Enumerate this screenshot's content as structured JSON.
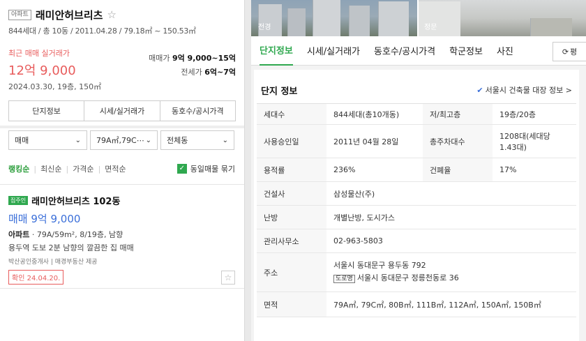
{
  "left": {
    "type_badge": "아파트",
    "name": "래미안허브리츠",
    "star": "☆",
    "info": "844세대 / 총 10동 / 2011.04.28 / 79.18㎡ ~ 150.53㎡",
    "recent_label": "최근 매매 실거래가",
    "recent_price": "12억 9,000",
    "recent_date": "2024.03.30, 19층, 150㎡",
    "sale_label": "매매가 ",
    "sale_value": "9억 9,000~15억",
    "jeonse_label": "전세가 ",
    "jeonse_value": "6억~7억",
    "tabs": [
      "단지정보",
      "시세/실거래가",
      "동호수/공시가격"
    ],
    "filters": [
      "매매",
      "79A㎡,79C⋯",
      "전체동"
    ],
    "sorts": [
      "랭킹순",
      "최신순",
      "가격순",
      "면적순"
    ],
    "bundle_label": "동일매물 묶기",
    "listing": {
      "badge": "집주인",
      "name": "래미안허브리츠 102동",
      "price": "매매 9억 9,000",
      "type": "아파트",
      "detail": " · 79A/59m², 8/19층, 남향",
      "desc": "용두역 도보 2분 남향의 깔끔한 집 매매",
      "agent": "박산공인중개사 | 매경부동산 제공",
      "confirm": "확인 24.04.20."
    }
  },
  "right": {
    "photo_labels": [
      "전경",
      "정문"
    ],
    "tabs": [
      "단지정보",
      "시세/실거래가",
      "동호수/공시가격",
      "학군정보",
      "사진"
    ],
    "refresh_label": "평",
    "info_title": "단지 정보",
    "bldg_link": "서울시 건축물 대장 정보 >",
    "rows": {
      "households_label": "세대수",
      "households": "844세대(총10개동)",
      "floors_label": "저/최고층",
      "floors": "19층/20층",
      "approval_label": "사용승인일",
      "approval": "2011년 04월 28일",
      "parking_label": "총주차대수",
      "parking": "1208대(세대당 1.43대)",
      "far_label": "용적률",
      "far": "236%",
      "bcr_label": "건폐율",
      "bcr": "17%",
      "builder_label": "건설사",
      "builder": "삼성물산(주)",
      "heating_label": "난방",
      "heating": "개별난방, 도시가스",
      "office_label": "관리사무소",
      "office": "02-963-5803",
      "address_label": "주소",
      "address": "서울시 동대문구 용두동 792",
      "road_badge": "도로명",
      "road_address": "서울시 동대문구 정릉천동로 36",
      "area_label": "면적",
      "area": "79A㎡, 79C㎡, 80B㎡, 111B㎡, 112A㎡, 150A㎡, 150B㎡"
    }
  },
  "colors": {
    "accent_green": "#2fa84f",
    "price_red": "#e85c5c",
    "price_blue": "#3b6fd9"
  }
}
